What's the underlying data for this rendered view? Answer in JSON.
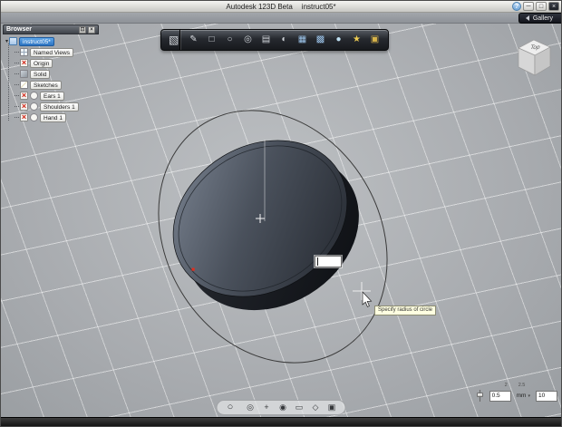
{
  "window": {
    "app_title": "Autodesk 123D Beta",
    "doc_title": "instruct05*",
    "controls": {
      "help": "?",
      "minimize": "─",
      "restore": "□",
      "close": "×"
    }
  },
  "topbar": {
    "gallery_label": "Gallery"
  },
  "browser": {
    "title": "Browser",
    "header_buttons": {
      "dock": "⊡",
      "close": "×"
    },
    "items": [
      {
        "name": "browser-item-document",
        "label": "instruct05*",
        "selected": true,
        "root": true,
        "icon": "document"
      },
      {
        "name": "browser-item-named-views",
        "label": "Named Views",
        "icon": "views"
      },
      {
        "name": "browser-item-origin",
        "label": "Origin",
        "icon": "origin",
        "hidden": true
      },
      {
        "name": "browser-item-solid",
        "label": "Solid",
        "icon": "solid"
      },
      {
        "name": "browser-item-sketches",
        "label": "Sketches",
        "icon": "sketches"
      },
      {
        "name": "browser-item-ears",
        "label": "Ears 1",
        "icon": "sketch",
        "hidden": true
      },
      {
        "name": "browser-item-shoulders",
        "label": "Shoulders 1",
        "icon": "sketch",
        "hidden": true
      },
      {
        "name": "browser-item-hand",
        "label": "Hand 1",
        "icon": "sketch",
        "hidden": true
      }
    ]
  },
  "toolbar": {
    "icons": [
      {
        "name": "primitives-menu-icon",
        "glyph": "▧",
        "color": "#d9dce1",
        "divider": true
      },
      {
        "name": "sketch-icon",
        "glyph": "✎",
        "color": "#d9dce1"
      },
      {
        "name": "box-primitive-icon",
        "glyph": "□",
        "color": "#cfd3d8"
      },
      {
        "name": "sphere-primitive-icon",
        "glyph": "○",
        "color": "#cfd3d8"
      },
      {
        "name": "cylinder-primitive-icon",
        "glyph": "◎",
        "color": "#cfd3d8"
      },
      {
        "name": "extrude-icon",
        "glyph": "▤",
        "color": "#cfd3d8"
      },
      {
        "name": "revolve-icon",
        "glyph": "◐",
        "color": "#cfd3d8"
      },
      {
        "name": "pattern-icon",
        "glyph": "▦",
        "color": "#9cc4ea"
      },
      {
        "name": "combine-icon",
        "glyph": "▩",
        "color": "#9cc4ea"
      },
      {
        "name": "material-icon",
        "glyph": "●",
        "color": "#bfe0f2"
      },
      {
        "name": "snap-settings-icon",
        "glyph": "★",
        "color": "#eccb52"
      },
      {
        "name": "folder-icon",
        "glyph": "▣",
        "color": "#d9b44a"
      }
    ]
  },
  "viewcube": {
    "top_label": "Top"
  },
  "canvas": {
    "radius_input_value": "",
    "tooltip_text": "Specify radius of circle"
  },
  "grid_controls": {
    "tick_labels": [
      "2",
      "2.5"
    ],
    "snap_value": "0.5",
    "units": "mm",
    "grid_size": "10"
  },
  "nav_toolbar": {
    "icons": [
      {
        "name": "view-sphere-icon",
        "glyph": "○"
      },
      {
        "name": "orbit-icon",
        "glyph": "◎"
      },
      {
        "name": "pan-icon",
        "glyph": "+"
      },
      {
        "name": "zoom-icon",
        "glyph": "◉"
      },
      {
        "name": "fit-view-icon",
        "glyph": "▭"
      },
      {
        "name": "look-at-icon",
        "glyph": "◇"
      },
      {
        "name": "display-settings-icon",
        "glyph": "▣"
      }
    ]
  }
}
